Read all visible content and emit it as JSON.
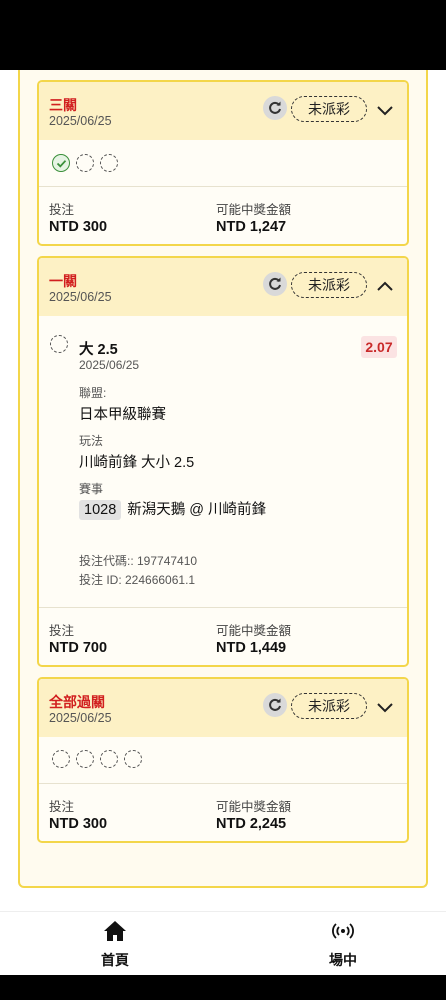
{
  "cards": [
    {
      "title": "三關",
      "date": "2025/06/25",
      "status": "未派彩",
      "stake_label": "投注",
      "stake": "NTD 300",
      "payout_label": "可能中獎金額",
      "payout": "NTD 1,247"
    },
    {
      "title": "一關",
      "date": "2025/06/25",
      "status": "未派彩",
      "selection": {
        "name": "大 2.5",
        "date": "2025/06/25",
        "odds": "2.07",
        "league_label": "聯盟:",
        "league": "日本甲級聯賽",
        "market_label": "玩法",
        "market": "川崎前鋒 大小 2.5",
        "event_label": "賽事",
        "event_id": "1028",
        "event": "新潟天鵝 @ 川崎前鋒",
        "bet_code": "投注代碼:: 197747410",
        "bet_id": "投注 ID: 224666061.1"
      },
      "stake_label": "投注",
      "stake": "NTD 700",
      "payout_label": "可能中獎金額",
      "payout": "NTD 1,449"
    },
    {
      "title": "全部過關",
      "date": "2025/06/25",
      "status": "未派彩",
      "stake_label": "投注",
      "stake": "NTD 300",
      "payout_label": "可能中獎金額",
      "payout": "NTD 2,245"
    }
  ],
  "nav": {
    "home_label": "首頁",
    "live_label": "場中",
    "home_icon": "home-icon",
    "live_icon": "broadcast-icon"
  },
  "colors": {
    "accent_border": "#f3d64a",
    "header_bg": "#fdf1c5",
    "title_red": "#d11f1f",
    "odds_bg": "#fbe3e3"
  }
}
